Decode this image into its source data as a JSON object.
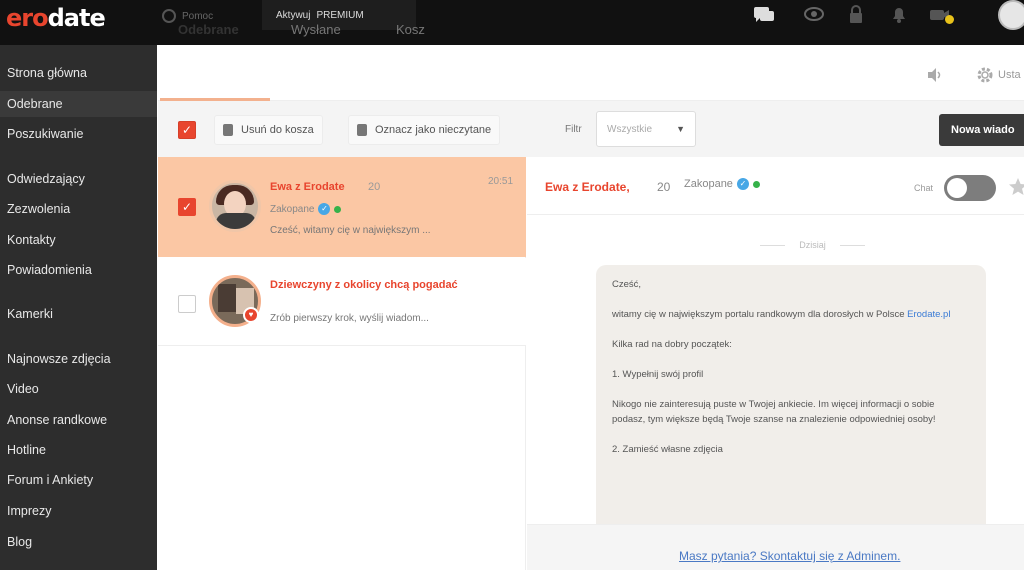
{
  "header": {
    "logo_part1": "ero",
    "logo_part2": "date",
    "search_label": "Pomoc",
    "activate_label": "Aktywuj",
    "premium_badge": "PREMIUM",
    "icons": [
      "chat-icon",
      "eye-icon",
      "lock-icon",
      "bell-icon",
      "camera-icon"
    ],
    "camera_badge_color": "#e8c21a"
  },
  "sidebar": {
    "items": [
      {
        "label": "Strona główna",
        "active": false
      },
      {
        "label": "Odebrane",
        "active": true
      },
      {
        "label": "Poszukiwanie",
        "active": false
      },
      {
        "label": "Odwiedzający",
        "active": false
      },
      {
        "label": "Zezwolenia",
        "active": false
      },
      {
        "label": "Kontakty",
        "active": false
      },
      {
        "label": "Powiadomienia",
        "active": false
      },
      {
        "label": "Kamerki",
        "active": false
      },
      {
        "label": "Najnowsze zdjęcia",
        "active": false
      },
      {
        "label": "Video",
        "active": false
      },
      {
        "label": "Anonse randkowe",
        "active": false
      },
      {
        "label": "Hotline",
        "active": false
      },
      {
        "label": "Forum i Ankiety",
        "active": false
      },
      {
        "label": "Imprezy",
        "active": false
      },
      {
        "label": "Blog",
        "active": false
      }
    ]
  },
  "tabs": [
    {
      "label": "Odebrane",
      "active": true
    },
    {
      "label": "Wysłane",
      "active": false
    },
    {
      "label": "Kosz",
      "active": false
    }
  ],
  "settings_label": "Usta",
  "toolbar": {
    "delete_label": "Usuń do kosza",
    "mark_unread_label": "Oznacz jako nieczytane",
    "filter_label": "Filtr",
    "filter_value": "Wszystkie",
    "new_message_label": "Nowa wiado"
  },
  "messages": [
    {
      "name": "Ewa z Erodate",
      "age": "20",
      "time": "20:51",
      "city": "Zakopane",
      "preview": "Cześć, witamy cię w największym ...",
      "checked": true,
      "highlighted": true
    },
    {
      "name": "Dziewczyny z okolicy chcą pogadać",
      "preview": "Zrób pierwszy krok, wyślij wiadom...",
      "checked": false,
      "highlighted": false
    }
  ],
  "conversation": {
    "name": "Ewa z Erodate,",
    "age": "20",
    "city": "Zakopane",
    "chat_label": "Chat",
    "chat_enabled": false,
    "day_label": "Dzisiaj",
    "body": {
      "greeting": "Cześć,",
      "welcome": "witamy cię w największym portalu randkowym dla dorosłych w Polsce",
      "welcome_link": "Erodate.pl",
      "intro": "Kilka rad na dobry początek:",
      "step1_title": "1. Wypełnij swój profil",
      "step1_text": "Nikogo nie zainteresują puste w Twojej ankiecie. Im więcej informacji o sobie podasz, tym większe będą Twoje szanse na znalezienie odpowiedniej osoby!",
      "step2_title": "2. Zamieść własne zdjęcia"
    },
    "footer_link": "Masz pytania? Skontaktuj się z Adminem."
  },
  "colors": {
    "accent": "#e8452e",
    "highlight_row": "#fbc7a4",
    "premium": "#c7a400",
    "verified": "#47a7e6",
    "online": "#36b24a"
  }
}
